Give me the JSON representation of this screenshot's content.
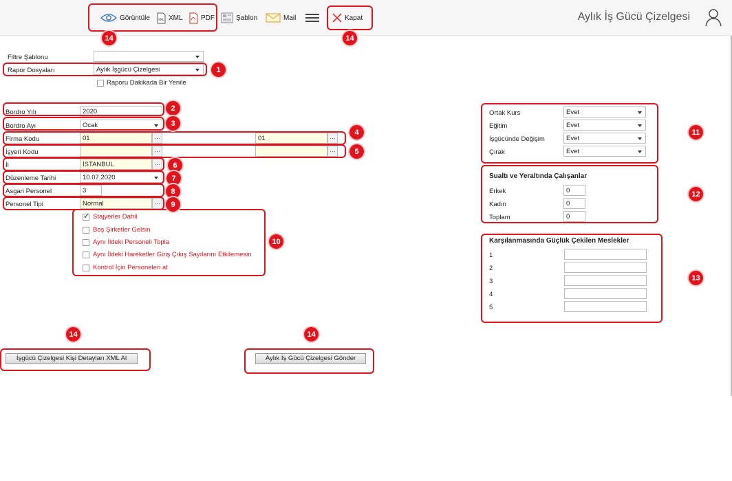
{
  "toolbar": {
    "view_label": "Görüntüle",
    "xml_label": "XML",
    "pdf_label": "PDF",
    "template_label": "Şablon",
    "mail_label": "Mail",
    "close_label": "Kapat"
  },
  "app_title": "Aylık İş Gücü Çizelgesi",
  "filter": {
    "template_label": "Filtre Şablonu",
    "template_value": "",
    "report_label": "Rapor Dosyaları",
    "report_value": "Aylık İşgücü Çizelgesi",
    "refresh_label": "Raporu Dakikada Bir Yenile"
  },
  "form": {
    "year_label": "Bordro Yılı",
    "year_value": "2020",
    "month_label": "Bordro Ayı",
    "month_value": "Ocak",
    "company_label": "Firma Kodu",
    "company_from": "01",
    "company_to": "01",
    "workplace_label": "İşyeri Kodu",
    "workplace_from": "",
    "workplace_to": "",
    "city_label": "İl",
    "city_value": "İSTANBUL",
    "date_label": "Düzenleme Tarihi",
    "date_value": "10.07.2020",
    "min_staff_label": "Asgari Personel",
    "min_staff_value": "3",
    "staff_type_label": "Personel Tipi",
    "staff_type_value": "Normal"
  },
  "options": [
    {
      "label": "Stajyerler Dahil",
      "checked": true
    },
    {
      "label": "Boş Şirketler Gelsin",
      "checked": false
    },
    {
      "label": "Aynı İldeki Personeli Topla",
      "checked": false
    },
    {
      "label": "Aynı İldeki Hareketler Giriş Çıkış Sayılarını Etkilemesin",
      "checked": false
    },
    {
      "label": "Kontrol İçin Personeleri at",
      "checked": false
    }
  ],
  "right_panel": {
    "flags": [
      {
        "label": "Ortak Kurs",
        "value": "Evet"
      },
      {
        "label": "Eğitim",
        "value": "Evet"
      },
      {
        "label": "İşgücünde Değişim",
        "value": "Evet"
      },
      {
        "label": "Çırak",
        "value": "Evet"
      }
    ],
    "underwater_title": "Sualtı ve Yeraltında Çalışanlar",
    "underwater": [
      {
        "label": "Erkek",
        "value": "0"
      },
      {
        "label": "Kadın",
        "value": "0"
      },
      {
        "label": "Toplam",
        "value": "0"
      }
    ],
    "professions_title": "Karşılanmasında Güçlük Çekilen Meslekler",
    "professions": [
      {
        "label": "1",
        "value": ""
      },
      {
        "label": "2",
        "value": ""
      },
      {
        "label": "3",
        "value": ""
      },
      {
        "label": "4",
        "value": ""
      },
      {
        "label": "5",
        "value": ""
      }
    ]
  },
  "actions": {
    "xml_details_label": "İşgücü Çizelgesi Kişi Detayları XML Al",
    "send_label": "Aylık İş Gücü Çizelgesi Gönder"
  },
  "badges": {
    "b1": "1",
    "b2": "2",
    "b3": "3",
    "b4": "4",
    "b5": "5",
    "b6": "6",
    "b7": "7",
    "b8": "8",
    "b9": "9",
    "b10": "10",
    "b11": "11",
    "b12": "12",
    "b13": "13",
    "b14": "14"
  },
  "colors": {
    "annotation": "#e0141c",
    "required_field": "#fffde4"
  }
}
